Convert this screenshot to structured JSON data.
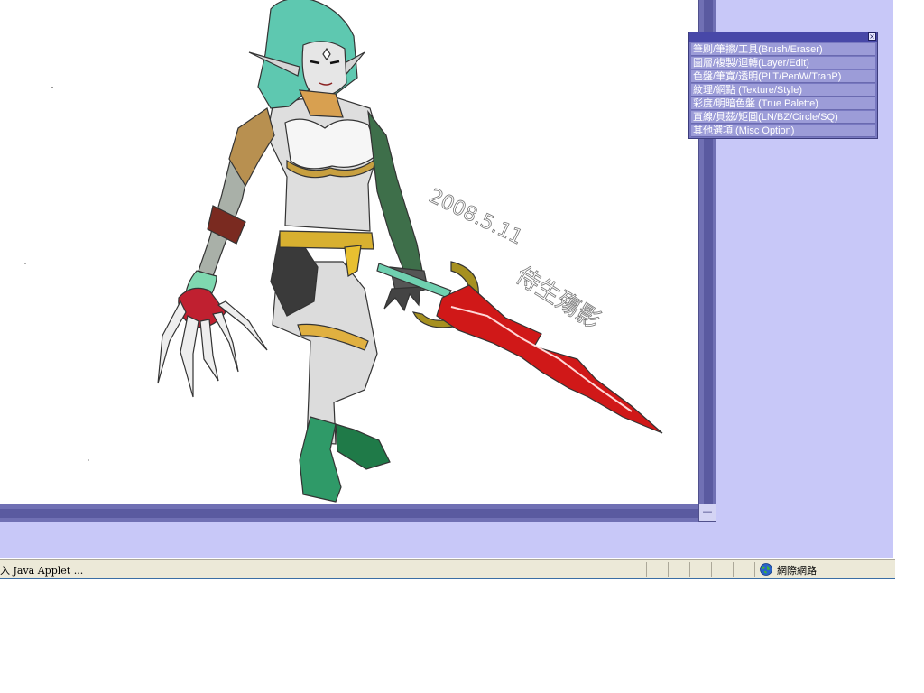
{
  "menu": {
    "close_glyph": "×",
    "items": [
      {
        "label": "筆刷/筆擦/工具(Brush/Eraser)"
      },
      {
        "label": "圖層/複製/迴轉(Layer/Edit)"
      },
      {
        "label": "色盤/筆寬/透明(PLT/PenW/TranP)"
      },
      {
        "label": "紋理/網點    (Texture/Style)"
      },
      {
        "label": "彩度/明暗色盤 (True Palette)"
      },
      {
        "label": "直線/貝茲/矩圓(LN/BZ/Circle/SQ)"
      },
      {
        "label": "其他選項     (Misc Option)"
      }
    ]
  },
  "canvas": {
    "signature_date": "2008.5.11",
    "signature_name": "侍生殤影",
    "corner_glyph": "—"
  },
  "statusbar": {
    "text": "入 Java Applet ...",
    "zone_label": "網際網路",
    "zone_icon": "globe-icon"
  },
  "colors": {
    "applet_bg": "#c8c8f8",
    "frame": "#7878b8",
    "menu_item": "#9c9cd8",
    "sword_red": "#d01818",
    "hair": "#5ec8b0"
  }
}
